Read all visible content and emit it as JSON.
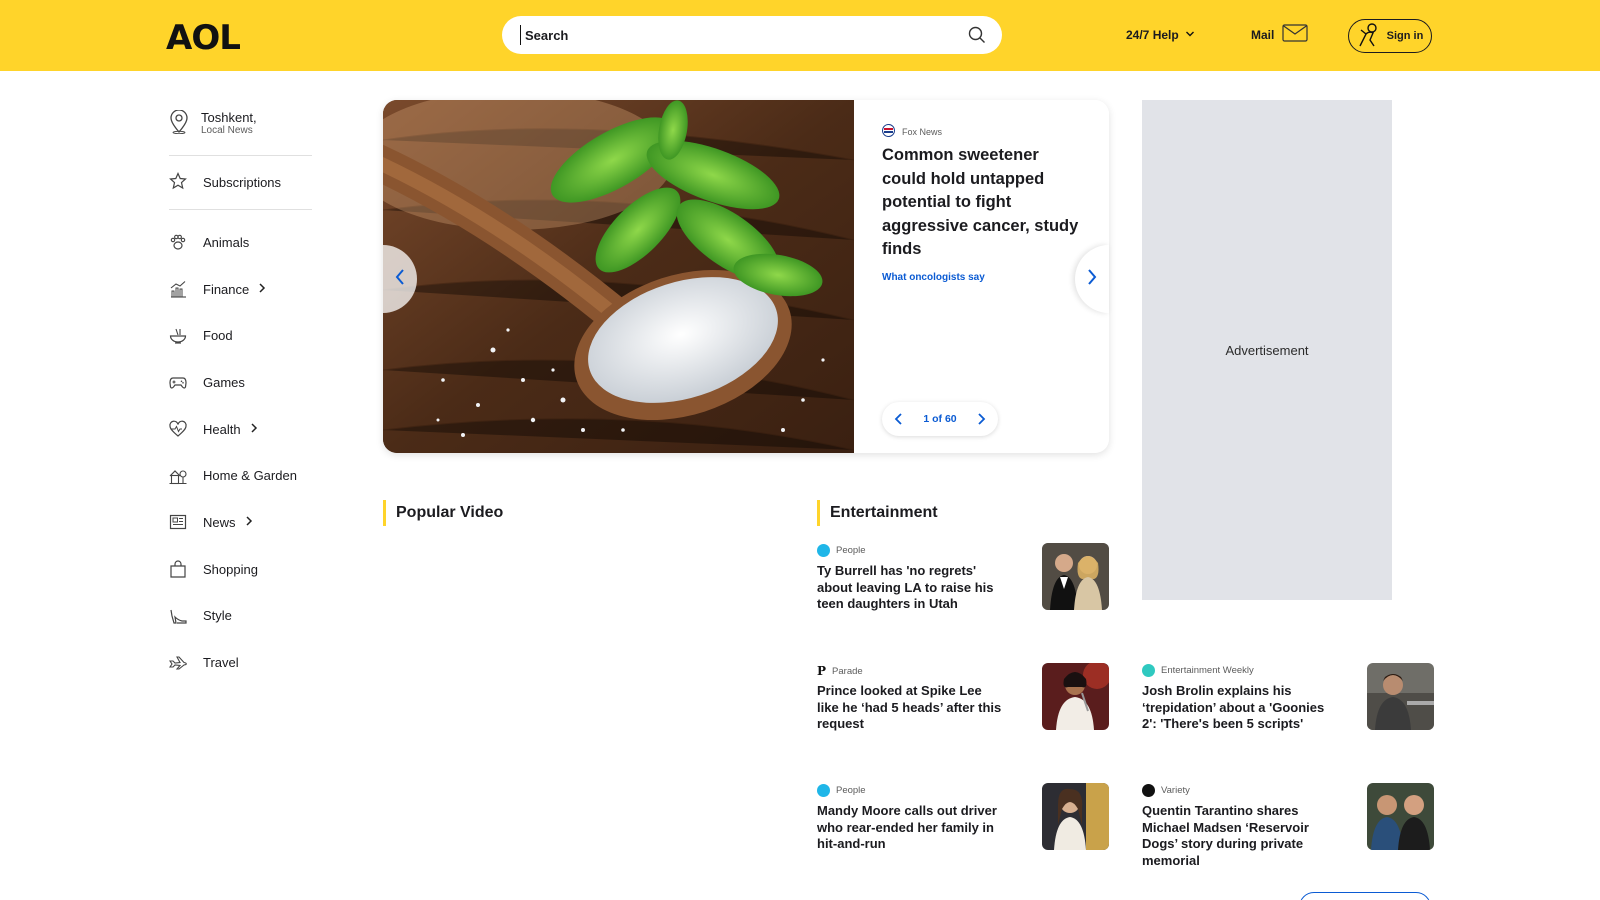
{
  "header": {
    "logo": "AOL",
    "search_placeholder": "Search",
    "help_label": "24/7 Help",
    "mail_label": "Mail",
    "signin_label": "Sign in"
  },
  "sidebar": {
    "location": {
      "city": "Toshkent,",
      "subtitle": "Local News"
    },
    "subscriptions_label": "Subscriptions",
    "items": [
      {
        "label": "Animals",
        "icon": "paw-icon",
        "has_submenu": false
      },
      {
        "label": "Finance",
        "icon": "chart-icon",
        "has_submenu": true
      },
      {
        "label": "Food",
        "icon": "bowl-icon",
        "has_submenu": false
      },
      {
        "label": "Games",
        "icon": "gamepad-icon",
        "has_submenu": false
      },
      {
        "label": "Health",
        "icon": "heart-pulse-icon",
        "has_submenu": true
      },
      {
        "label": "Home & Garden",
        "icon": "house-tree-icon",
        "has_submenu": false
      },
      {
        "label": "News",
        "icon": "newspaper-icon",
        "has_submenu": true
      },
      {
        "label": "Shopping",
        "icon": "shopping-bag-icon",
        "has_submenu": false
      },
      {
        "label": "Style",
        "icon": "high-heel-icon",
        "has_submenu": false
      },
      {
        "label": "Travel",
        "icon": "airplane-icon",
        "has_submenu": false
      }
    ]
  },
  "hero": {
    "source": "Fox News",
    "headline": "Common sweetener could hold untapped potential to fight aggressive cancer, study finds",
    "teaser": "What oncologists say",
    "pager": "1 of 60"
  },
  "ad": {
    "label": "Advertisement"
  },
  "sections": {
    "popular_video": "Popular Video",
    "entertainment": "Entertainment"
  },
  "articles": [
    {
      "source": "People",
      "title": "Ty Burrell has 'no regrets' about leaving LA to raise his teen daughters in Utah",
      "badge_color": "#1fb6e8",
      "badge": "people"
    },
    {
      "source": "Parade",
      "title": "Prince looked at Spike Lee like he ‘had 5 heads’ after this request",
      "badge_color": "#111111",
      "badge": "parade"
    },
    {
      "source": "Entertainment Weekly",
      "title": "Josh Brolin explains his ‘trepidation’ about a 'Goonies 2': 'There's been 5 scripts'",
      "badge_color": "#2fc9c0",
      "badge": "ew"
    },
    {
      "source": "People",
      "title": "Mandy Moore calls out driver who rear-ended her family in hit-and-run",
      "badge_color": "#1fb6e8",
      "badge": "people"
    },
    {
      "source": "Variety",
      "title": "Quentin Tarantino shares Michael Madsen ‘Reservoir Dogs’ story during private memorial",
      "badge_color": "#111111",
      "badge": "variety"
    }
  ],
  "colors": {
    "brand_yellow": "#ffd42a",
    "link_blue": "#0b5bd3",
    "ad_gray": "#e1e3e8"
  }
}
